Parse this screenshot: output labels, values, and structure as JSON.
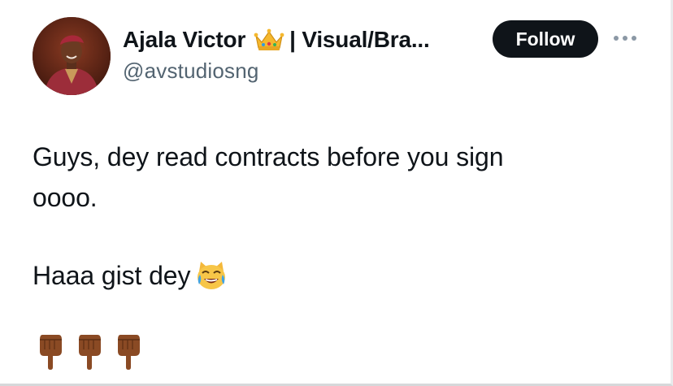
{
  "author": {
    "display_name": "Ajala Victor",
    "name_suffix": "| Visual/Bra...",
    "handle": "@avstudiosng",
    "avatar_icon": "profile-photo",
    "badge_icon": "crown-emoji"
  },
  "actions": {
    "follow_label": "Follow",
    "more_icon": "more-horizontal-icon"
  },
  "tweet": {
    "line1": "Guys, dey read contracts before you sign",
    "line2": "oooo.",
    "line3": "Haaa gist dey",
    "line3_emoji": "crying-laughing-cat-emoji",
    "footer_emojis": [
      "backhand-index-pointing-down-emoji",
      "backhand-index-pointing-down-emoji",
      "backhand-index-pointing-down-emoji"
    ]
  },
  "colors": {
    "text": "#0f1419",
    "secondary_text": "#536471",
    "follow_button_bg": "#0f1419",
    "follow_button_text": "#ffffff"
  }
}
